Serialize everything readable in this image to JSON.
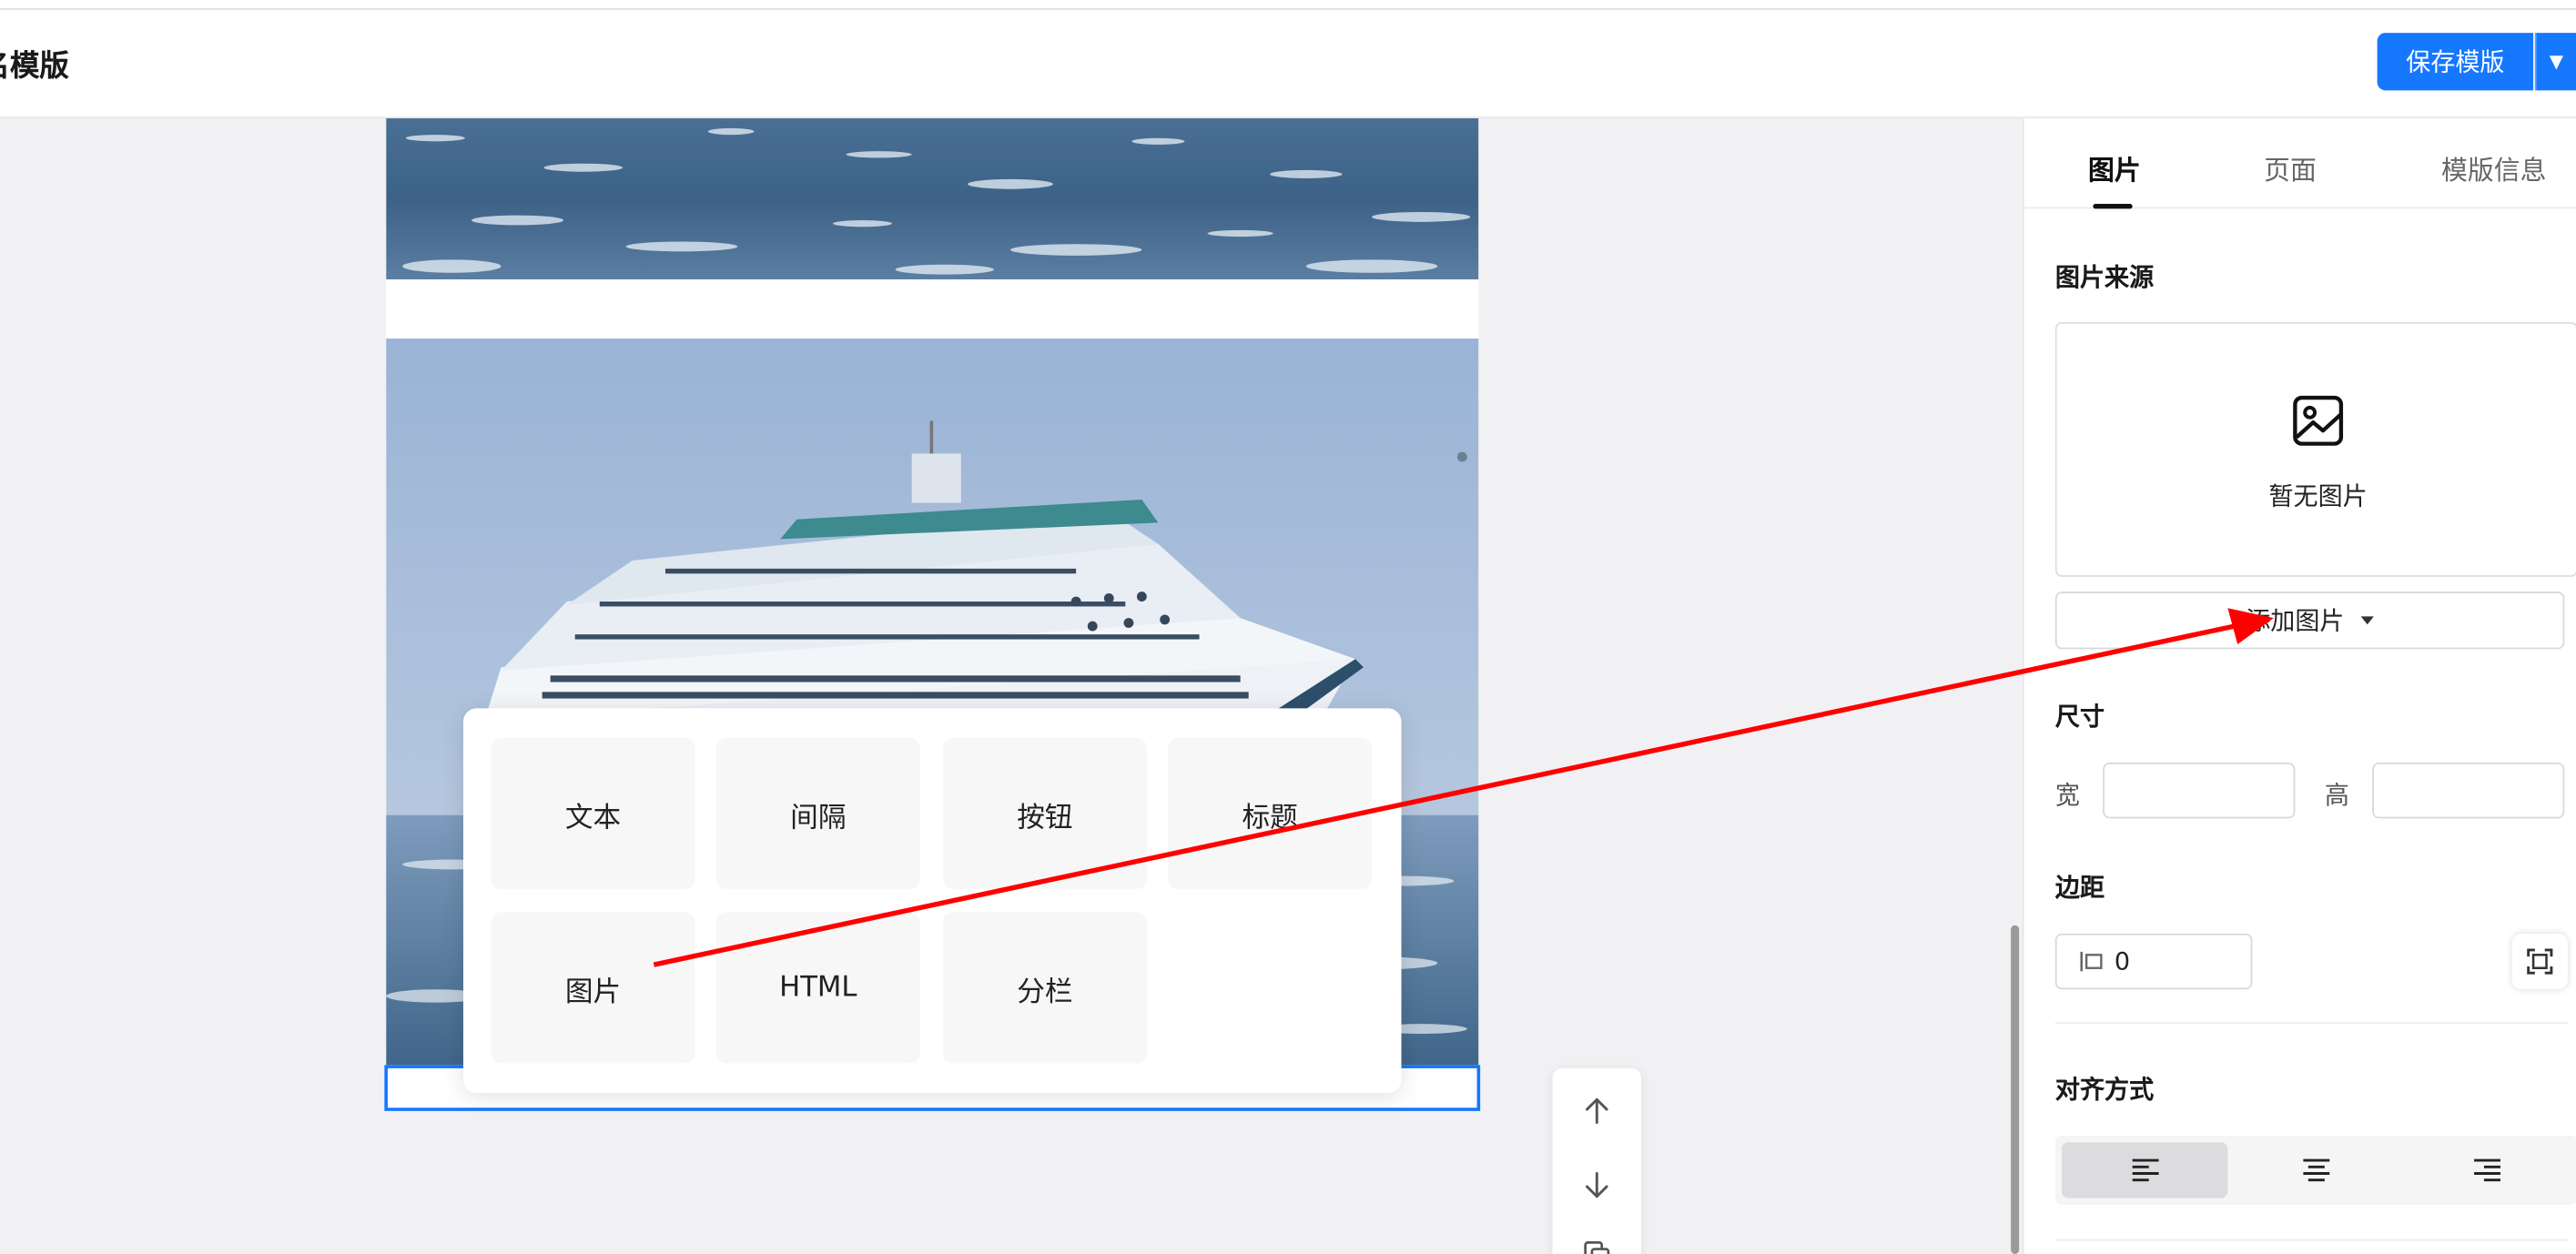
{
  "header": {
    "title": "名模版",
    "save_label": "保存模版",
    "save_dropdown": "▼"
  },
  "components_popup": {
    "items": [
      "文本",
      "间隔",
      "按钮",
      "标题",
      "图片",
      "HTML",
      "分栏"
    ]
  },
  "right_panel": {
    "tabs": [
      "图片",
      "页面",
      "模版信息"
    ],
    "active_tab": "图片",
    "image_source": {
      "heading": "图片来源",
      "placeholder_text": "暂无图片",
      "add_button_label": "添加图片"
    },
    "size": {
      "heading": "尺寸",
      "width_label": "宽",
      "height_label": "高",
      "width_value": "",
      "height_value": ""
    },
    "margin": {
      "heading": "边距",
      "value": "0"
    },
    "alignment": {
      "heading": "对齐方式",
      "options": [
        "align-left",
        "align-center",
        "align-right"
      ],
      "selected": "align-left"
    }
  },
  "colors": {
    "accent": "#1677ff",
    "annotation_arrow": "#ff0000"
  },
  "icons": [
    "image-icon",
    "caret-down-icon",
    "arrow-up-icon",
    "arrow-down-icon",
    "copy-icon",
    "padding-icon",
    "expand-corners-icon",
    "align-left-icon",
    "align-center-icon",
    "align-right-icon"
  ]
}
